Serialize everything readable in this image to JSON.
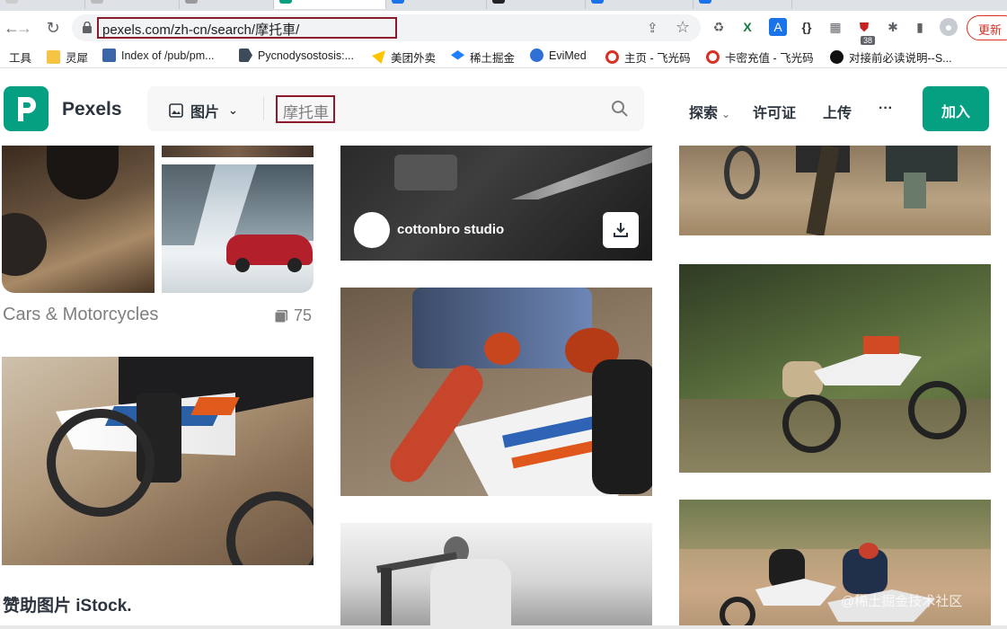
{
  "browser": {
    "tabs": [
      "",
      "",
      "",
      "",
      "",
      "",
      "",
      ""
    ],
    "url": "pexels.com/zh-cn/search/摩托車/",
    "update_label": "更新",
    "ext_badge": "38"
  },
  "bookmarks": [
    {
      "label": "工具",
      "icon": "none"
    },
    {
      "label": "灵犀",
      "icon": "folder-icon"
    },
    {
      "label": "Index of /pub/pm...",
      "icon": "page-icon"
    },
    {
      "label": "Pycnodysostosis:...",
      "icon": "tag-icon"
    },
    {
      "label": "美团外卖",
      "icon": "yellow-flag-icon"
    },
    {
      "label": "稀土掘金",
      "icon": "juejin-icon"
    },
    {
      "label": "EviMed",
      "icon": "evimed-icon"
    },
    {
      "label": "主页 - 飞光码",
      "icon": "red-circle-icon"
    },
    {
      "label": "卡密充值 - 飞光码",
      "icon": "red-circle-icon"
    },
    {
      "label": "对接前必读说明--S...",
      "icon": "black-circle-icon"
    }
  ],
  "header": {
    "brand": "Pexels",
    "search_type": "图片",
    "query": "摩托車",
    "nav": [
      "探索",
      "许可证",
      "上传",
      "···"
    ],
    "join": "加入"
  },
  "collection": {
    "title": "Cars & Motorcycles",
    "count": "75"
  },
  "photo_author": "cottonbro studio",
  "sponsor": "赞助图片 iStock.",
  "watermark": "@稀土掘金技术社区",
  "colors": {
    "brand": "#05a081",
    "highlight": "#8b1a2b",
    "text": "#2c343e",
    "muted": "#7f7f7f"
  }
}
